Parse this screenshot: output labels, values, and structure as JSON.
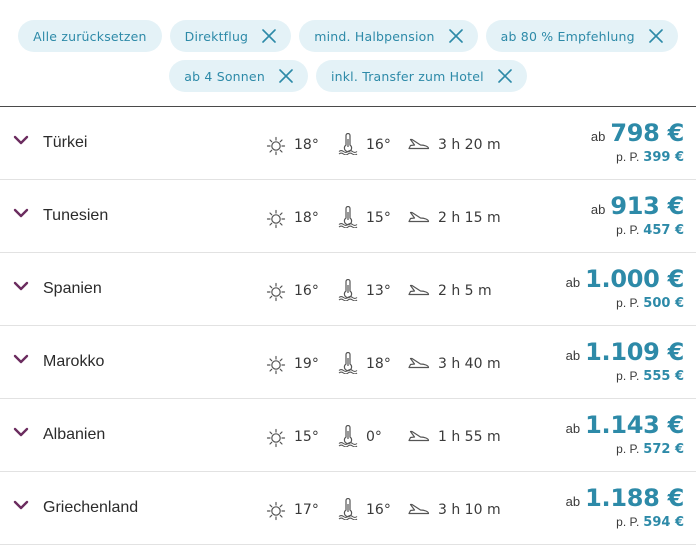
{
  "filters": {
    "row1": [
      "Alle zurücksetzen",
      "Direktflug",
      "mind. Halbpension",
      "ab 80 % Empfehlung"
    ],
    "row2": [
      "ab 4 Sonnen",
      "inkl. Transfer zum Hotel"
    ]
  },
  "labels": {
    "ab": "ab",
    "per_person": "p. P."
  },
  "destinations": [
    {
      "country": "Türkei",
      "air_temp": "18°",
      "water_temp": "16°",
      "flight_time": "3 h 20 m",
      "price": "798 €",
      "price_pp": "399 €"
    },
    {
      "country": "Tunesien",
      "air_temp": "18°",
      "water_temp": "15°",
      "flight_time": "2 h 15 m",
      "price": "913 €",
      "price_pp": "457 €"
    },
    {
      "country": "Spanien",
      "air_temp": "16°",
      "water_temp": "13°",
      "flight_time": "2 h 5 m",
      "price": "1.000 €",
      "price_pp": "500 €"
    },
    {
      "country": "Marokko",
      "air_temp": "19°",
      "water_temp": "18°",
      "flight_time": "3 h 40 m",
      "price": "1.109 €",
      "price_pp": "555 €"
    },
    {
      "country": "Albanien",
      "air_temp": "15°",
      "water_temp": "0°",
      "flight_time": "1 h 55 m",
      "price": "1.143 €",
      "price_pp": "572 €"
    },
    {
      "country": "Griechenland",
      "air_temp": "17°",
      "water_temp": "16°",
      "flight_time": "3 h 10 m",
      "price": "1.188 €",
      "price_pp": "594 €"
    }
  ],
  "icons": {
    "row_toggle": "chevron-down-icon",
    "air": "sun-icon",
    "water": "water-temperature-icon",
    "flight": "plane-icon",
    "remove": "close-icon"
  },
  "colors": {
    "accent": "#2d8aa8",
    "chip_bg": "#e4f2f7",
    "chevron": "#6b2c5f"
  }
}
